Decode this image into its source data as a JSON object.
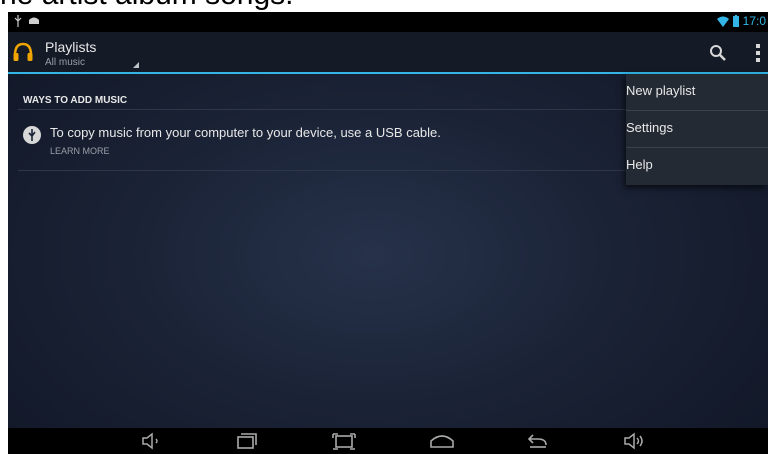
{
  "caption": "he artist album songs.",
  "status_bar": {
    "time": "17:0",
    "icons": [
      "usb-icon",
      "android-icon",
      "wifi-icon",
      "battery-icon"
    ]
  },
  "action_bar": {
    "title": "Playlists",
    "subtitle": "All music",
    "icons": [
      "headphones-icon",
      "search-icon",
      "overflow-menu-icon"
    ]
  },
  "content": {
    "section_header": "WAYS TO ADD MUSIC",
    "items": [
      {
        "icon": "usb-icon",
        "text": "To copy music from your computer to your device, use a USB cable.",
        "link": "LEARN MORE"
      }
    ]
  },
  "overflow_menu": {
    "items": [
      "New playlist",
      "Settings",
      "Help"
    ]
  },
  "nav_bar": {
    "buttons": [
      "volume-down-icon",
      "recent-apps-icon",
      "screenshot-icon",
      "home-icon",
      "back-icon",
      "volume-up-icon"
    ]
  },
  "colors": {
    "accent": "#33b5e5",
    "action_bar": "#141a26",
    "menu": "#242a33"
  }
}
